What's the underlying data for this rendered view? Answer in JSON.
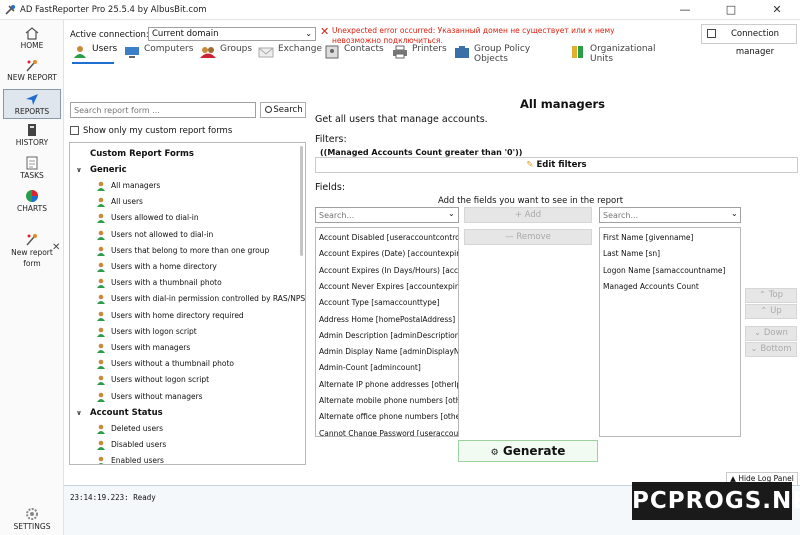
{
  "window": {
    "title": "AD FastReporter Pro 25.5.4 by AlbusBit.com"
  },
  "nav": {
    "home": "HOME",
    "new_report": "NEW REPORT",
    "reports": "REPORTS",
    "history": "HISTORY",
    "tasks": "TASKS",
    "charts": "CHARTS",
    "new_report_form": "New report form",
    "settings": "SETTINGS"
  },
  "connection": {
    "label": "Active connection:",
    "value": "Current domain",
    "error": "Unexpected error occurred: Указанный домен не существует или к нему невозможно подключиться.",
    "manager_button": "Connection manager"
  },
  "tabs": [
    {
      "label": "Users"
    },
    {
      "label": "Computers"
    },
    {
      "label": "Groups"
    },
    {
      "label": "Exchange"
    },
    {
      "label": "Contacts"
    },
    {
      "label": "Printers"
    },
    {
      "label": "Group Policy Objects"
    },
    {
      "label": "Organizational Units"
    }
  ],
  "search": {
    "placeholder": "Search report form ...",
    "button": "Search"
  },
  "custom_only": "Show only my custom report forms",
  "tree": {
    "header": "Custom Report Forms",
    "groups": [
      {
        "name": "Generic",
        "items": [
          "All managers",
          "All users",
          "Users allowed to dial-in",
          "Users not allowed to dial-in",
          "Users that belong to more than one group",
          "Users with a home directory",
          "Users with a thumbnail photo",
          "Users with dial-in permission controlled by RAS/NPS",
          "Users with home directory required",
          "Users with logon script",
          "Users with managers",
          "Users without a thumbnail photo",
          "Users without logon script",
          "Users without managers"
        ]
      },
      {
        "name": "Account Status",
        "items": [
          "Deleted users",
          "Disabled users",
          "Enabled users"
        ]
      }
    ]
  },
  "report": {
    "title": "All managers",
    "description": "Get all users that manage accounts.",
    "filters_label": "Filters:",
    "filter_text": "((Managed Accounts Count greater than '0'))",
    "edit_filters": "Edit filters",
    "fields_label": "Fields:",
    "fields_hint": "Add the fields you want to see in the report",
    "search_placeholder": "Search...",
    "add": "Add",
    "remove": "Remove",
    "available": [
      "Account Disabled [useraccountcontrol]",
      "Account Expires (Date) [accountexpires]",
      "Account Expires (In Days/Hours) [accountexpires]",
      "Account Never Expires [accountexpires]",
      "Account Type [samaccounttype]",
      "Address Home [homePostalAddress]",
      "Admin Description [adminDescription]",
      "Admin Display Name [adminDisplayName]",
      "Admin-Count [admincount]",
      "Alternate IP phone addresses [otherIpPhone]",
      "Alternate mobile phone numbers [otherMobile]",
      "Alternate office phone numbers [otherTelephone]",
      "Cannot Change Password [useraccountcontrol]"
    ],
    "selected": [
      "First Name [givenname]",
      "Last Name [sn]",
      "Logon Name [samaccountname]",
      "Managed Accounts Count"
    ],
    "order": {
      "top": "Top",
      "up": "Up",
      "down": "Down",
      "bottom": "Bottom"
    },
    "generate": "Generate",
    "hide_log": "Hide Log Panel"
  },
  "log": {
    "line": "23:14:19.223: Ready"
  },
  "watermark": "PCPROGS.NET"
}
